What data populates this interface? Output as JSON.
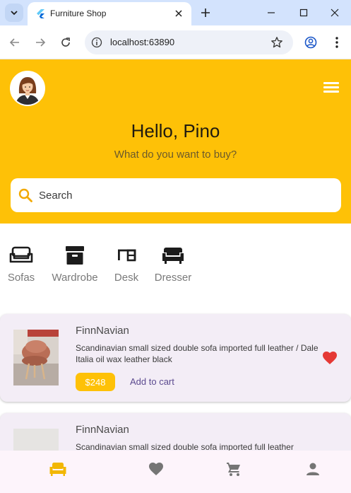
{
  "browser": {
    "tab_title": "Furniture Shop",
    "url": "localhost:63890"
  },
  "header": {
    "greeting": "Hello, Pino",
    "subtitle": "What do you want to buy?",
    "search_placeholder": "Search"
  },
  "categories": [
    {
      "label": "Sofas",
      "icon": "sofa-icon"
    },
    {
      "label": "Wardrobe",
      "icon": "wardrobe-icon"
    },
    {
      "label": "Desk",
      "icon": "desk-icon"
    },
    {
      "label": "Dresser",
      "icon": "armchair-icon"
    }
  ],
  "products": [
    {
      "name": "FinnNavian",
      "description": "Scandinavian small sized double sofa imported full leather / Dale Italia oil wax leather black",
      "price": "$248",
      "add_to_cart": "Add to cart",
      "favorite": true
    },
    {
      "name": "FinnNavian",
      "description": "Scandinavian small sized double sofa imported full leather",
      "price": "",
      "add_to_cart": "",
      "favorite": false
    }
  ],
  "bottom_nav": [
    {
      "icon": "sofa-icon",
      "active": true
    },
    {
      "icon": "heart-icon",
      "active": false
    },
    {
      "icon": "cart-icon",
      "active": false
    },
    {
      "icon": "person-icon",
      "active": false
    }
  ],
  "colors": {
    "accent": "#fec107",
    "favorite": "#e53935",
    "card_bg": "#f3edf6",
    "link": "#5b4a8f"
  }
}
